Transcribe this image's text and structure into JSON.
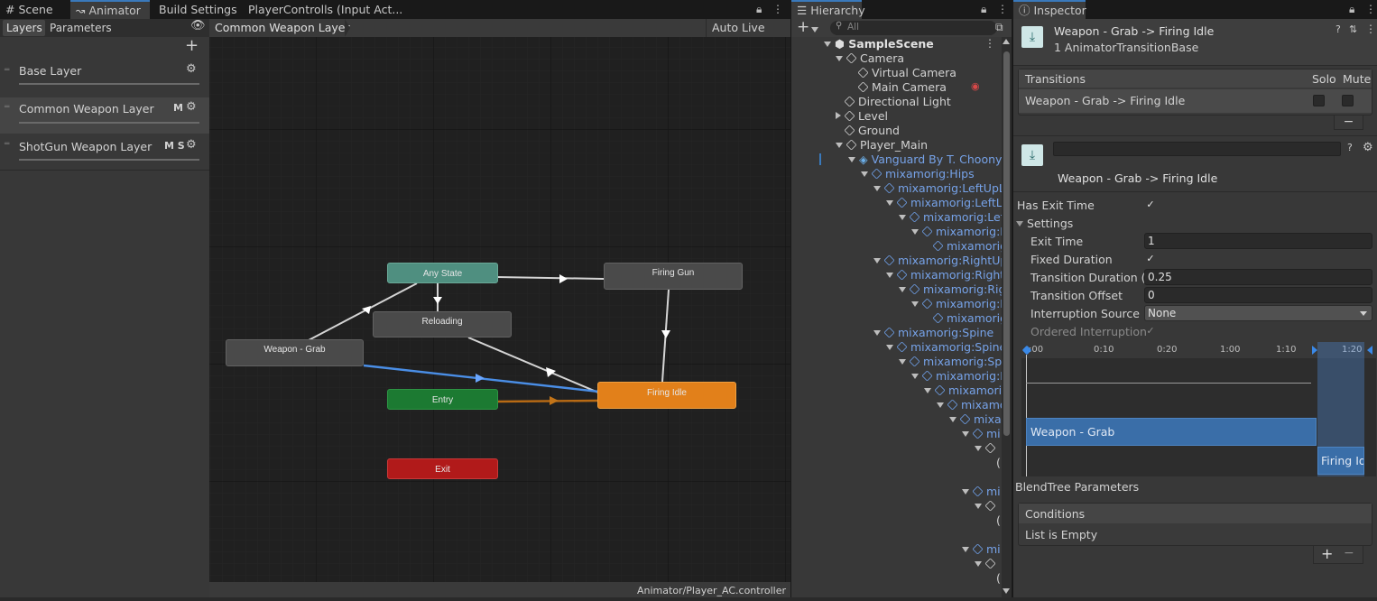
{
  "tabs_left": [
    {
      "label": "Scene",
      "icon": "grid-icon"
    },
    {
      "label": "Animator",
      "icon": "animator-icon"
    },
    {
      "label": "Build Settings"
    },
    {
      "label": "PlayerControlls (Input Act..."
    }
  ],
  "layers_panel": {
    "tab_layers": "Layers",
    "tab_parameters": "Parameters",
    "layers": [
      {
        "name": "Base Layer",
        "flags": ""
      },
      {
        "name": "Common Weapon Layer",
        "flags": "M"
      },
      {
        "name": "ShotGun Weapon Layer",
        "flags": "M S"
      }
    ]
  },
  "graph": {
    "breadcrumb": "Common Weapon Layer",
    "auto_live_link": "Auto Live Link",
    "footer_path": "Animator/Player_AC.controller",
    "nodes": {
      "any_state": "Any State",
      "firing_gun": "Firing Gun",
      "reloading": "Reloading",
      "weapon_grab": "Weapon - Grab",
      "entry": "Entry",
      "firing_idle": "Firing Idle",
      "exit": "Exit"
    },
    "colors": {
      "any_state": "#4f8f80",
      "entry": "#1c7a32",
      "exit": "#b11a1a",
      "default_state": "#4a4a4a",
      "firing_idle": "#e2801a",
      "selected_transition": "#4a8ee6",
      "entry_transition": "#b86a14"
    }
  },
  "hierarchy": {
    "title": "Hierarchy",
    "search_placeholder": "All",
    "scene": "SampleScene",
    "items": [
      "Camera",
      "Virtual Camera",
      "Main Camera",
      "Directional Light",
      "Level",
      "Ground",
      "Player_Main",
      "Vanguard By T. Choonyu",
      "mixamorig:Hips",
      "mixamorig:LeftUpLe",
      "mixamorig:LeftLe",
      "mixamorig:Left",
      "mixamorig:Le",
      "mixamorig:",
      "mixamorig:RightUpLe",
      "mixamorig:RightL",
      "mixamorig:Righ",
      "mixamorig:R",
      "mixamorig",
      "mixamorig:Spine",
      "mixamorig:Spine1",
      "mixamorig:Spi",
      "mixamorig:Le",
      "mixamorig",
      "mixamo",
      "mixa",
      "mi",
      "mi",
      "mi"
    ]
  },
  "inspector": {
    "title": "Inspector",
    "header_title": "Weapon - Grab -> Firing Idle",
    "header_sub": "1 AnimatorTransitionBase",
    "transitions_label": "Transitions",
    "solo": "Solo",
    "mute": "Mute",
    "transition_item": "Weapon - Grab -> Firing Idle",
    "detail_title": "Weapon - Grab -> Firing Idle",
    "has_exit_time": "Has Exit Time",
    "settings": "Settings",
    "exit_time_label": "Exit Time",
    "exit_time": "1",
    "fixed_duration_label": "Fixed Duration",
    "transition_duration_label": "Transition Duration (s)",
    "transition_duration": "0.25",
    "transition_offset_label": "Transition Offset",
    "transition_offset": "0",
    "interruption_source_label": "Interruption Source",
    "interruption_source": "None",
    "ordered_interruption_label": "Ordered Interruption",
    "timeline_ticks": [
      ":00",
      "0:10",
      "0:20",
      "1:00",
      "1:10",
      "1:20"
    ],
    "timeline_clip_a": "Weapon - Grab",
    "timeline_clip_b": "Firing Idl",
    "blendtree": "BlendTree Parameters",
    "conditions": "Conditions",
    "conditions_empty": "List is Empty",
    "minus": "−",
    "plus": "+"
  }
}
